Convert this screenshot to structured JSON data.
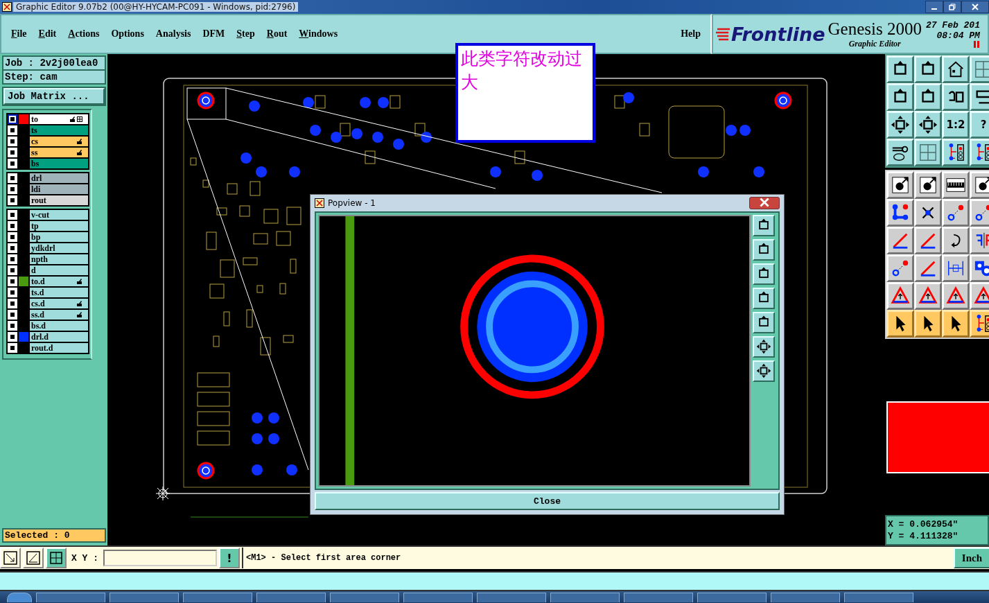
{
  "window": {
    "title": "Graphic Editor 9.07b2 (00@HY-HYCAM-PC091 - Windows, pid:2796)"
  },
  "menu": [
    {
      "label": "File",
      "mnemonic": true
    },
    {
      "label": "Edit",
      "mnemonic": true
    },
    {
      "label": "Actions",
      "mnemonic": true
    },
    {
      "label": "Options",
      "mnemonic": false
    },
    {
      "label": "Analysis",
      "mnemonic": false
    },
    {
      "label": "DFM",
      "mnemonic": false
    },
    {
      "label": "Step",
      "mnemonic": true
    },
    {
      "label": "Rout",
      "mnemonic": true
    },
    {
      "label": "Windows",
      "mnemonic": true
    }
  ],
  "help": "Help",
  "brand": {
    "logo": "Frontline",
    "product": "Genesis 2000",
    "subtitle": "Graphic Editor",
    "date": "27 Feb 201",
    "time": "08:04 PM"
  },
  "job": {
    "job": "Job : 2v2j00lea0",
    "step": "Step: cam",
    "matrix_button": "Job Matrix ..."
  },
  "layer_groups": [
    [
      {
        "name": "to",
        "kind": "work",
        "color": "#ff0000",
        "affected": true,
        "work_layer": true
      },
      {
        "name": "ts",
        "kind": "mask",
        "affected": false,
        "work_layer": false
      },
      {
        "name": "cs",
        "kind": "signal",
        "affected": true,
        "work_layer": false
      },
      {
        "name": "ss",
        "kind": "signal",
        "affected": true,
        "work_layer": false
      },
      {
        "name": "bs",
        "kind": "mask",
        "affected": false,
        "work_layer": false
      }
    ],
    [
      {
        "name": "drl",
        "kind": "drill",
        "affected": false,
        "work_layer": false
      },
      {
        "name": "ldi",
        "kind": "drill",
        "affected": false,
        "work_layer": false
      },
      {
        "name": "rout",
        "kind": "rout",
        "affected": false,
        "work_layer": false
      }
    ],
    [
      {
        "name": "v-cut",
        "kind": "document",
        "affected": false,
        "work_layer": false
      },
      {
        "name": "tp",
        "kind": "document",
        "affected": false,
        "work_layer": false
      },
      {
        "name": "bp",
        "kind": "document",
        "affected": false,
        "work_layer": false
      },
      {
        "name": "ydkdrl",
        "kind": "document",
        "affected": false,
        "work_layer": false
      },
      {
        "name": "npth",
        "kind": "document",
        "affected": false,
        "work_layer": false
      },
      {
        "name": "d",
        "kind": "document",
        "affected": false,
        "work_layer": false
      },
      {
        "name": "to.d",
        "kind": "document",
        "color": "#4a9a10",
        "affected": true,
        "work_layer": false
      },
      {
        "name": "ts.d",
        "kind": "document",
        "affected": false,
        "work_layer": false
      },
      {
        "name": "cs.d",
        "kind": "document",
        "affected": true,
        "work_layer": false
      },
      {
        "name": "ss.d",
        "kind": "document",
        "affected": true,
        "work_layer": false
      },
      {
        "name": "bs.d",
        "kind": "document",
        "affected": false,
        "work_layer": false
      },
      {
        "name": "drl.d",
        "kind": "document",
        "color": "#0030ff",
        "affected": false,
        "work_layer": false
      },
      {
        "name": "rout.d",
        "kind": "document",
        "affected": false,
        "work_layer": false
      }
    ]
  ],
  "selected": "Selected : 0",
  "note": "此类字符改动过大",
  "popview": {
    "title": "Popview - 1",
    "close": "Close"
  },
  "tool_labels": [
    "1:2",
    "?"
  ],
  "command": {
    "label": "X Y :",
    "alert": "!",
    "message": "<M1> - Select first area corner",
    "units": "Inch"
  },
  "coords": [
    "X = 0.062954\"",
    "Y = 4.111328\""
  ]
}
